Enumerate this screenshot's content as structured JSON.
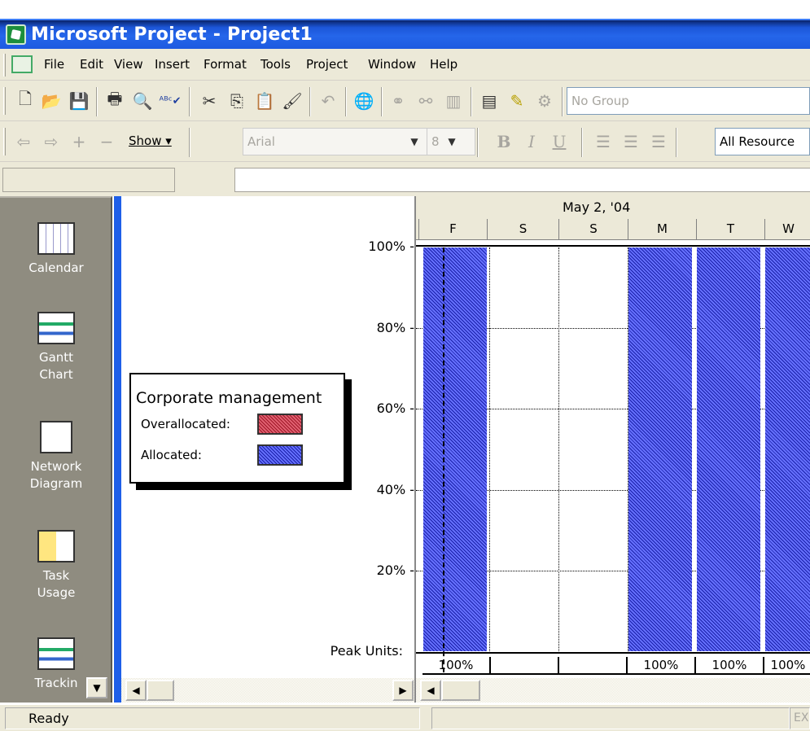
{
  "window": {
    "title": "Microsoft Project - Project1"
  },
  "menu": [
    "File",
    "Edit",
    "View",
    "Insert",
    "Format",
    "Tools",
    "Project",
    "Window",
    "Help"
  ],
  "toolbar1": {
    "group_combo": "No Group"
  },
  "toolbar2": {
    "show_label": "Show ▾",
    "font_combo": "Arial",
    "size_combo": "8",
    "bold": "B",
    "italic": "I",
    "underline": "U",
    "filter_combo": "All Resource"
  },
  "viewbar": [
    {
      "label": "Calendar",
      "icon": "calendar-view-icon"
    },
    {
      "label": "Gantt Chart",
      "icon": "gantt-chart-icon"
    },
    {
      "label": "Network Diagram",
      "icon": "network-diagram-icon"
    },
    {
      "label": "Task Usage",
      "icon": "task-usage-icon"
    },
    {
      "label": "Trackin",
      "icon": "tracking-gantt-icon"
    }
  ],
  "legend": {
    "title": "Corporate management",
    "over_label": "Overallocated:",
    "alloc_label": "Allocated:",
    "over_color": "#cc3344",
    "alloc_color": "#3a44d0"
  },
  "yaxis": {
    "labels": [
      "100% -",
      "80% -",
      "60% -",
      "40% -",
      "20% -"
    ],
    "peak_label": "Peak Units:"
  },
  "timescale": {
    "week": "May 2, '04",
    "days": [
      "F",
      "S",
      "S",
      "M",
      "T",
      "W"
    ]
  },
  "peaks": [
    "100%",
    "",
    "",
    "100%",
    "100%",
    "100%"
  ],
  "status": {
    "text": "Ready",
    "ext": "EX"
  },
  "chart_data": {
    "type": "bar",
    "categories": [
      "F",
      "S",
      "S",
      "M",
      "T",
      "W"
    ],
    "values": [
      100,
      0,
      0,
      100,
      100,
      100
    ],
    "ylim": [
      0,
      100
    ],
    "series": [
      {
        "name": "Allocated",
        "values": [
          100,
          0,
          0,
          100,
          100,
          100
        ]
      },
      {
        "name": "Overallocated",
        "values": [
          0,
          0,
          0,
          0,
          0,
          0
        ]
      }
    ]
  }
}
